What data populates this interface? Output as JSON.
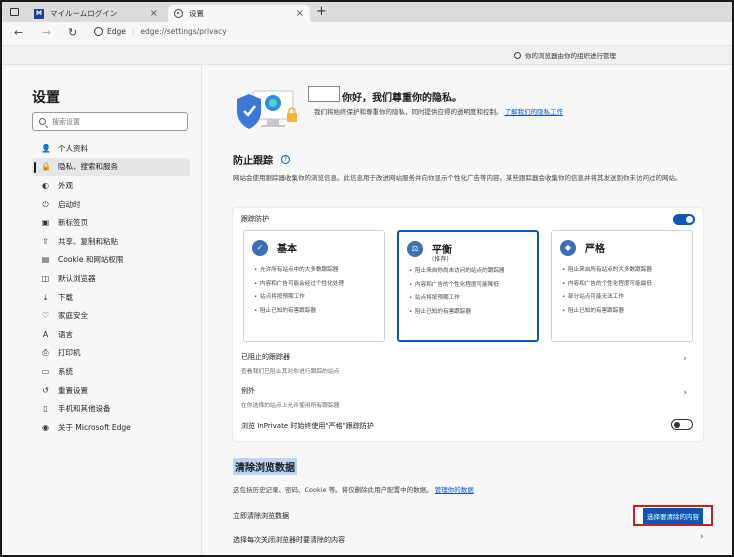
{
  "browser": {
    "tabs": [
      {
        "label": "マイルームログイン",
        "favicon": "M",
        "active": false
      },
      {
        "label": "设置",
        "active": true
      }
    ],
    "address": {
      "site_label": "Edge",
      "url": "edge://settings/privacy"
    },
    "managed_banner": "你的浏览器由你的组织进行管理"
  },
  "sidebar": {
    "title": "设置",
    "search_placeholder": "搜索设置",
    "items": [
      {
        "label": "个人资料",
        "icon": "user-icon"
      },
      {
        "label": "隐私、搜索和服务",
        "icon": "lock-icon",
        "selected": true
      },
      {
        "label": "外观",
        "icon": "appearance-icon"
      },
      {
        "label": "启动时",
        "icon": "power-icon"
      },
      {
        "label": "新标签页",
        "icon": "newtab-icon"
      },
      {
        "label": "共享、复制和粘贴",
        "icon": "share-icon"
      },
      {
        "label": "Cookie 和网站权限",
        "icon": "cookie-icon"
      },
      {
        "label": "默认浏览器",
        "icon": "browser-icon"
      },
      {
        "label": "下载",
        "icon": "download-icon"
      },
      {
        "label": "家庭安全",
        "icon": "family-icon"
      },
      {
        "label": "语言",
        "icon": "language-icon"
      },
      {
        "label": "打印机",
        "icon": "printer-icon"
      },
      {
        "label": "系统",
        "icon": "system-icon"
      },
      {
        "label": "重置设置",
        "icon": "reset-icon"
      },
      {
        "label": "手机和其他设备",
        "icon": "phone-icon"
      },
      {
        "label": "关于 Microsoft Edge",
        "icon": "edge-icon"
      }
    ]
  },
  "hero": {
    "greeting": "你好，我们尊重你的隐私。",
    "description": "我们将始终保护和尊重你的隐私，同时提供应得的透明度和控制。",
    "link": "了解我们的隐私工作"
  },
  "tracking": {
    "title": "防止跟踪",
    "description": "网站会使用跟踪器收集你的浏览信息。此信息用于改进网站服务并向你显示个性化广告等内容。某些跟踪器会收集你的信息并将其发送到你未访问过的网站。",
    "protection_label": "跟踪防护",
    "protection_on": true,
    "levels": [
      {
        "title": "基本",
        "subtitle": "",
        "bullets": [
          "允许所有站点中的大多数跟踪器",
          "内容和广告可能会经过个性化处理",
          "站点将按预期工作",
          "阻止已知的有害跟踪器"
        ]
      },
      {
        "title": "平衡",
        "subtitle": "(推荐)",
        "selected": true,
        "bullets": [
          "阻止来自你尚未访问的站点的跟踪器",
          "内容和广告的个性化程度可能降低",
          "站点将按预期工作",
          "阻止已知的有害跟踪器"
        ]
      },
      {
        "title": "严格",
        "subtitle": "",
        "bullets": [
          "阻止来自所有站点的大多数跟踪器",
          "内容和广告的个性化程度可能最低",
          "部分站点可能无法工作",
          "阻止已知的有害跟踪器"
        ]
      }
    ],
    "blocked": {
      "title": "已阻止的跟踪器",
      "subtitle": "查看我们已阻止其对你进行跟踪的站点"
    },
    "exceptions": {
      "title": "例外",
      "subtitle": "在你选择的站点上允许使用所有跟踪器"
    },
    "inprivate_label": "浏览 InPrivate 时始终使用\"严格\"跟踪防护",
    "inprivate_on": false
  },
  "clear": {
    "title": "清除浏览数据",
    "description": "这包括历史记录、密码、Cookie 等。将仅删除此用户配置中的数据。",
    "description_link": "管理你的数据",
    "clear_now": "立即清除浏览数据",
    "choose_button": "选择要清除的内容",
    "each_close": "选择每次关闭浏览器时要清除的内容"
  }
}
